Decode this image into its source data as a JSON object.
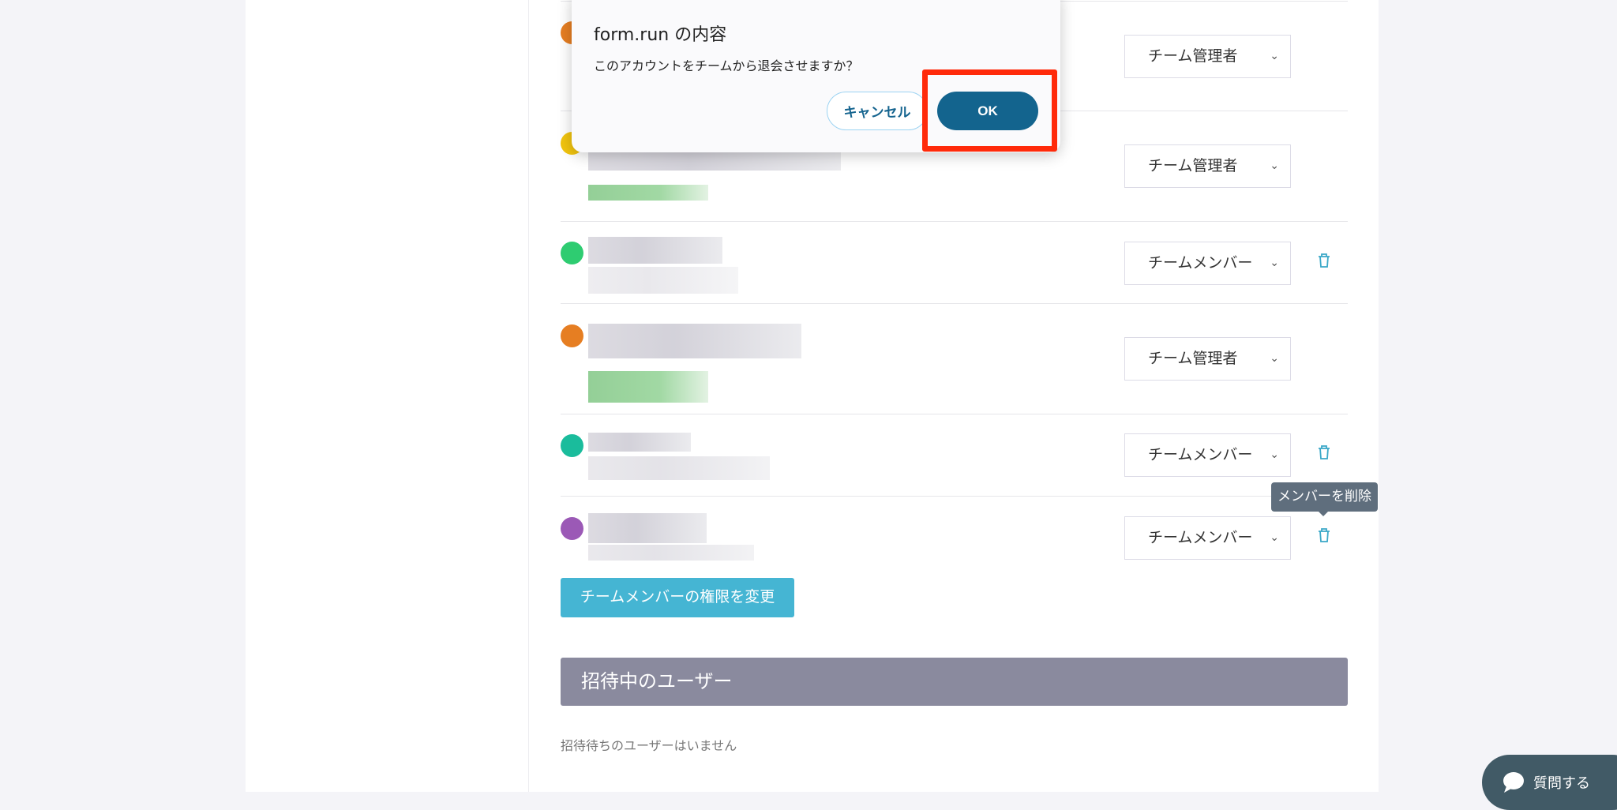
{
  "dialog": {
    "title": "form.run の内容",
    "message": "このアカウントをチームから退会させますか？",
    "cancel_label": "キャンセル",
    "ok_label": "OK"
  },
  "members": [
    {
      "role": "チーム管理者",
      "deletable": false,
      "avatar_color": "#e67e22"
    },
    {
      "role": "チーム管理者",
      "deletable": false,
      "avatar_color": "#f1c40f"
    },
    {
      "role": "チームメンバー",
      "deletable": true,
      "avatar_color": "#2ecc71"
    },
    {
      "role": "チーム管理者",
      "deletable": false,
      "avatar_color": "#e67e22"
    },
    {
      "role": "チームメンバー",
      "deletable": true,
      "avatar_color": "#1abc9c"
    },
    {
      "role": "チームメンバー",
      "deletable": true,
      "avatar_color": "#9b59b6"
    }
  ],
  "tooltip": "メンバーを削除",
  "change_permissions_label": "チームメンバーの権限を変更",
  "invited": {
    "heading": "招待中のユーザー",
    "empty": "招待待ちのユーザーはいません"
  },
  "chat": {
    "label": "質問する"
  },
  "colors": {
    "accent": "#45b5d3",
    "ok": "#13648e",
    "highlight": "#ff2a0a"
  }
}
